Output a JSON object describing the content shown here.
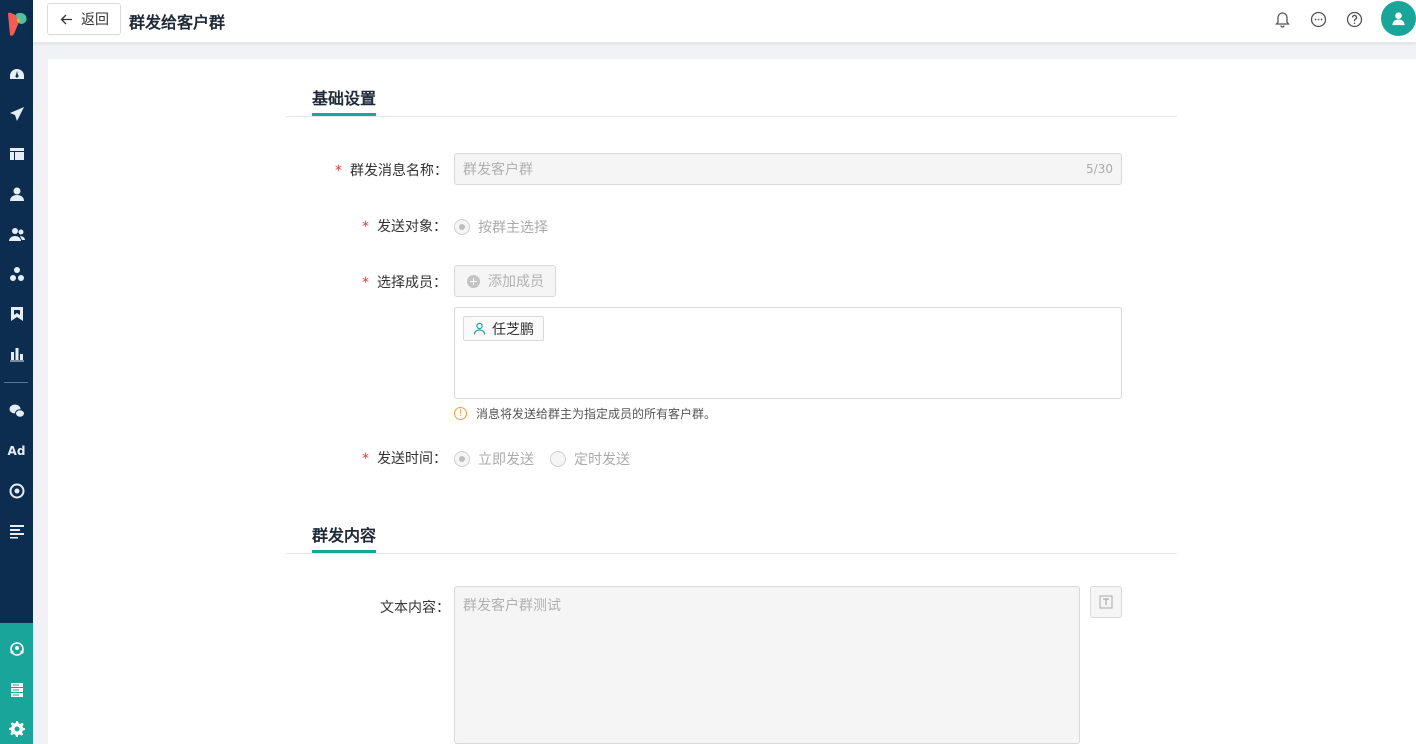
{
  "header": {
    "back_label": "返回",
    "title": "群发给客户群"
  },
  "sidebar": {
    "ad_label": "Ad",
    "icons": [
      "dashboard-icon",
      "send-icon",
      "table-icon",
      "user-icon",
      "users-icon",
      "org-icon",
      "bookmark-icon",
      "chart-icon",
      "wechat-icon",
      "ad-icon",
      "target-icon",
      "list-icon",
      "group-icon",
      "server-icon",
      "settings-icon"
    ]
  },
  "sections": {
    "basic": "基础设置",
    "content": "群发内容"
  },
  "form": {
    "name_label": "群发消息名称：",
    "name_value": "群发客户群",
    "name_count": "5/30",
    "target_label": "发送对象：",
    "target_option": "按群主选择",
    "member_label": "选择成员：",
    "add_member_label": "添加成员",
    "members": [
      "任芝鹏"
    ],
    "hint": "消息将发送给群主为指定成员的所有客户群。",
    "time_label": "发送时间：",
    "time_options": [
      "立即发送",
      "定时发送"
    ],
    "text_label": "文本内容：",
    "text_value": "群发客户群测试",
    "required_mark": "*"
  },
  "colors": {
    "sidebar": "#0c2d4f",
    "accent": "#1aa59a",
    "required": "#e53935",
    "warning": "#f0a030"
  }
}
